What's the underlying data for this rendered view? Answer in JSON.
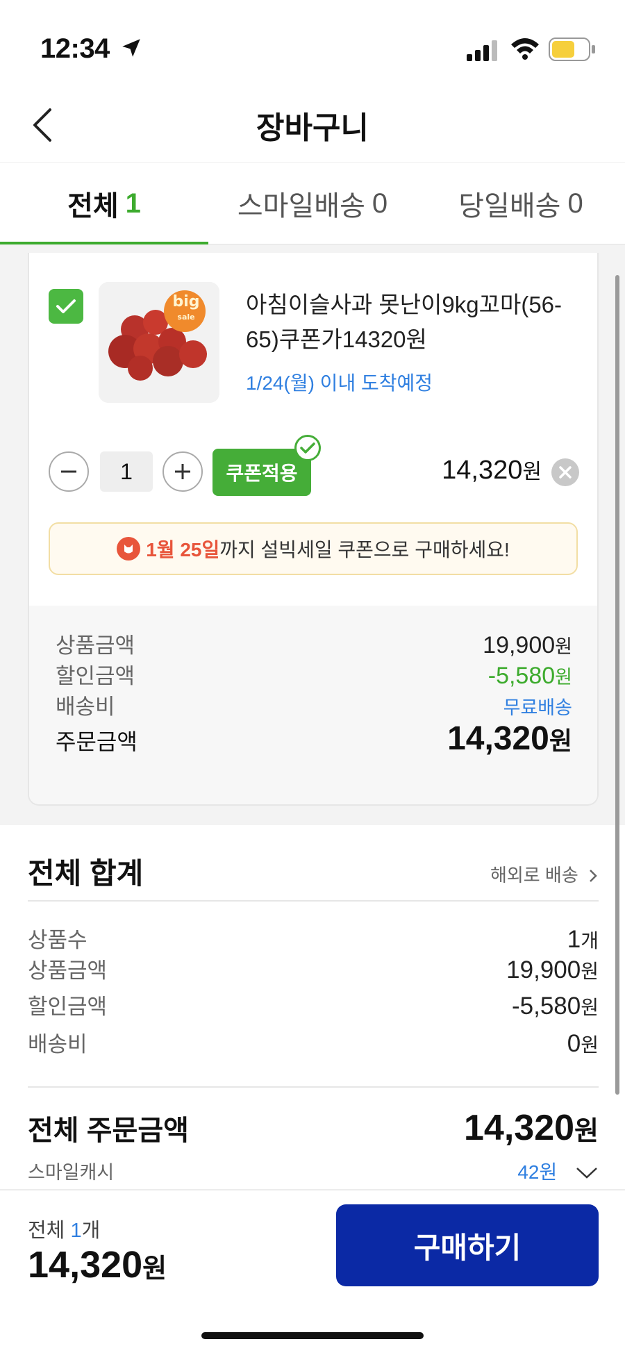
{
  "status": {
    "time": "12:34"
  },
  "header": {
    "title": "장바구니"
  },
  "tabs": [
    {
      "label": "전체",
      "count": "1"
    },
    {
      "label": "스마일배송",
      "count": "0"
    },
    {
      "label": "당일배송",
      "count": "0"
    }
  ],
  "cart_item": {
    "thumb_badge": "big",
    "thumb_badge_sub": "sale",
    "name": "아침이슬사과 못난이9kg꼬마(56-65)쿠폰가14320원",
    "arrival": "1/24(월) 이내 도착예정",
    "quantity": "1",
    "coupon_label": "쿠폰적용",
    "price": "14,320",
    "price_unit": "원"
  },
  "promo": {
    "date": "1월 25일",
    "text": "까지 설빅세일 쿠폰으로 구매하세요!"
  },
  "item_summary": {
    "product_amount_label": "상품금액",
    "product_amount": "19,900",
    "unit": "원",
    "discount_label": "할인금액",
    "discount": "-5,580",
    "shipping_label": "배송비",
    "shipping": "무료배송",
    "order_label": "주문금액",
    "order_amount": "14,320"
  },
  "grand_summary": {
    "title": "전체 합계",
    "overseas_label": "해외로 배송",
    "count_label": "상품수",
    "count": "1",
    "count_unit": "개",
    "product_amount_label": "상품금액",
    "product_amount": "19,900",
    "discount_label": "할인금액",
    "discount": "-5,580",
    "shipping_label": "배송비",
    "shipping": "0",
    "unit": "원",
    "total_label": "전체 주문금액",
    "total": "14,320",
    "cash_label": "스마일캐시",
    "cash": "42원"
  },
  "footer": {
    "count_label": "전체",
    "count": "1",
    "count_unit": "개",
    "total": "14,320",
    "unit": "원",
    "buy_label": "구매하기"
  },
  "colors": {
    "accent_green": "#3dab2e",
    "link_blue": "#2f7fe0",
    "buy_button": "#0b29a5",
    "promo_red": "#e8553b"
  }
}
